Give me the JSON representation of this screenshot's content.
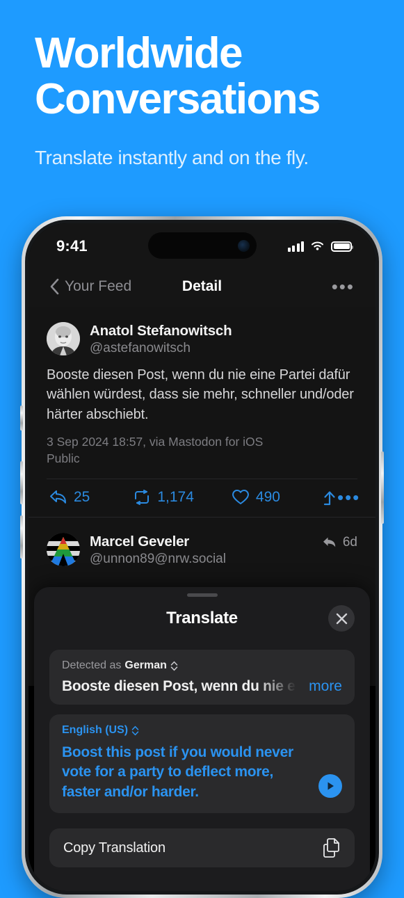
{
  "promo": {
    "title_line1": "Worldwide",
    "title_line2": "Conversations",
    "subtitle": "Translate instantly and on the fly.",
    "bg_color": "#1e9bff"
  },
  "status_bar": {
    "time": "9:41",
    "signal_icon": "cellular-bars-icon",
    "wifi_icon": "wifi-icon",
    "battery_icon": "battery-full-icon"
  },
  "nav_bar": {
    "back_label": "Your Feed",
    "back_icon": "chevron-left-icon",
    "title": "Detail",
    "more_label": "•••"
  },
  "feed": {
    "posts": [
      {
        "author": "Anatol Stefanowitsch",
        "handle": "@astefanowitsch",
        "avatar_icon": "avatar-photo-portrait",
        "body": "Booste diesen Post, wenn du nie eine Partei dafür wählen würdest, dass sie mehr, schneller und/oder härter abschiebt.",
        "meta": "3 Sep 2024 18:57, via Mastodon for iOS",
        "visibility": "Public"
      },
      {
        "author": "Marcel Geveler",
        "handle": "@unnon89@nrw.social",
        "avatar_icon": "avatar-rainbow-triangle",
        "reply_icon": "reply-arrow-icon",
        "time_ago": "6d"
      }
    ],
    "actions": {
      "reply_icon": "reply-arrow-icon",
      "reply_count": "25",
      "boost_icon": "boost-repeat-icon",
      "boost_count": "1,174",
      "favorite_icon": "heart-icon",
      "favorite_count": "490",
      "share_icon": "share-arrow-up-icon",
      "more_label": "•••",
      "accent_color": "#2b8ae0"
    }
  },
  "translate_sheet": {
    "grabber": "sheet-grabber",
    "title": "Translate",
    "close_icon": "close-x-icon",
    "source": {
      "detected_prefix": "Detected as",
      "detected_language": "German",
      "chevron_icon": "chevron-up-down-icon",
      "text": "Booste diesen Post, wenn du nie eine Partei dafür wählen",
      "more_label": "more"
    },
    "target": {
      "language": "English (US)",
      "chevron_icon": "chevron-up-down-icon",
      "text": "Boost this post if you would never vote for a party to deflect more, faster and/or harder.",
      "play_icon": "play-circle-icon",
      "accent_color": "#2b93f0"
    },
    "copy_row": {
      "label": "Copy Translation",
      "icon": "copy-documents-icon"
    }
  }
}
